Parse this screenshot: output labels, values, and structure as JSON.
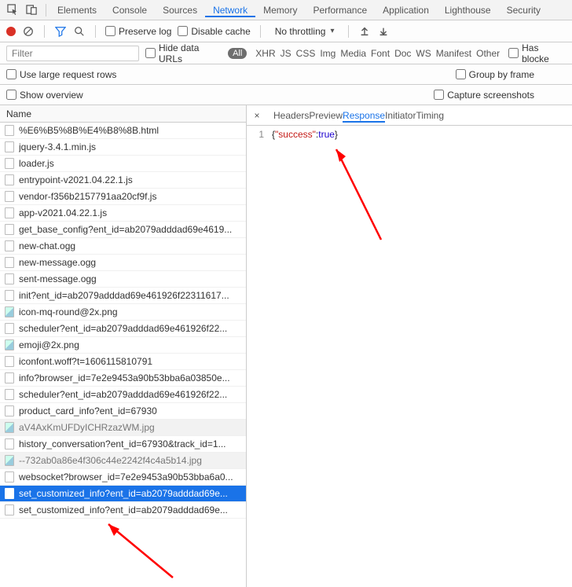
{
  "topTabs": {
    "items": [
      "Elements",
      "Console",
      "Sources",
      "Network",
      "Memory",
      "Performance",
      "Application",
      "Lighthouse",
      "Security"
    ],
    "activeIndex": 3
  },
  "toolbar": {
    "preserveLog": "Preserve log",
    "disableCache": "Disable cache",
    "throttling": "No throttling"
  },
  "filter": {
    "placeholder": "Filter",
    "hideDataUrls": "Hide data URLs",
    "allPill": "All",
    "types": [
      "XHR",
      "JS",
      "CSS",
      "Img",
      "Media",
      "Font",
      "Doc",
      "WS",
      "Manifest",
      "Other"
    ],
    "hasBlocked": "Has blocke"
  },
  "opts": {
    "useLarge": "Use large request rows",
    "groupByFrame": "Group by frame",
    "showOverview": "Show overview",
    "captureScreens": "Capture screenshots"
  },
  "nameHeader": "Name",
  "requests": [
    {
      "name": "%E6%B5%8B%E4%B8%8B.html",
      "t": "doc"
    },
    {
      "name": "jquery-3.4.1.min.js",
      "t": "js"
    },
    {
      "name": "loader.js",
      "t": "js"
    },
    {
      "name": "entrypoint-v2021.04.22.1.js",
      "t": "js"
    },
    {
      "name": "vendor-f356b2157791aa20cf9f.js",
      "t": "js"
    },
    {
      "name": "app-v2021.04.22.1.js",
      "t": "js"
    },
    {
      "name": "get_base_config?ent_id=ab2079adddad69e4619...",
      "t": "xhr"
    },
    {
      "name": "new-chat.ogg",
      "t": "media"
    },
    {
      "name": "new-message.ogg",
      "t": "media"
    },
    {
      "name": "sent-message.ogg",
      "t": "media"
    },
    {
      "name": "init?ent_id=ab2079adddad69e461926f22311617...",
      "t": "xhr"
    },
    {
      "name": "icon-mq-round@2x.png",
      "t": "img"
    },
    {
      "name": "scheduler?ent_id=ab2079adddad69e461926f22...",
      "t": "xhr"
    },
    {
      "name": "emoji@2x.png",
      "t": "img"
    },
    {
      "name": "iconfont.woff?t=1606115810791",
      "t": "font"
    },
    {
      "name": "info?browser_id=7e2e9453a90b53bba6a03850e...",
      "t": "xhr"
    },
    {
      "name": "scheduler?ent_id=ab2079adddad69e461926f22...",
      "t": "xhr"
    },
    {
      "name": "product_card_info?ent_id=67930",
      "t": "xhr"
    },
    {
      "name": "aV4AxKmUFDyICHRzazWM.jpg",
      "t": "img",
      "gray": true
    },
    {
      "name": "history_conversation?ent_id=67930&track_id=1...",
      "t": "xhr"
    },
    {
      "name": "--732ab0a86e4f306c44e2242f4c4a5b14.jpg",
      "t": "img",
      "gray": true
    },
    {
      "name": "websocket?browser_id=7e2e9453a90b53bba6a0...",
      "t": "ws"
    },
    {
      "name": "set_customized_info?ent_id=ab2079adddad69e...",
      "t": "xhr",
      "sel": true
    },
    {
      "name": "set_customized_info?ent_id=ab2079adddad69e...",
      "t": "xhr"
    }
  ],
  "detailTabs": {
    "items": [
      "Headers",
      "Preview",
      "Response",
      "Initiator",
      "Timing"
    ],
    "activeIndex": 2
  },
  "response": {
    "lineNo": "1",
    "key": "\"success\"",
    "value": "true"
  }
}
